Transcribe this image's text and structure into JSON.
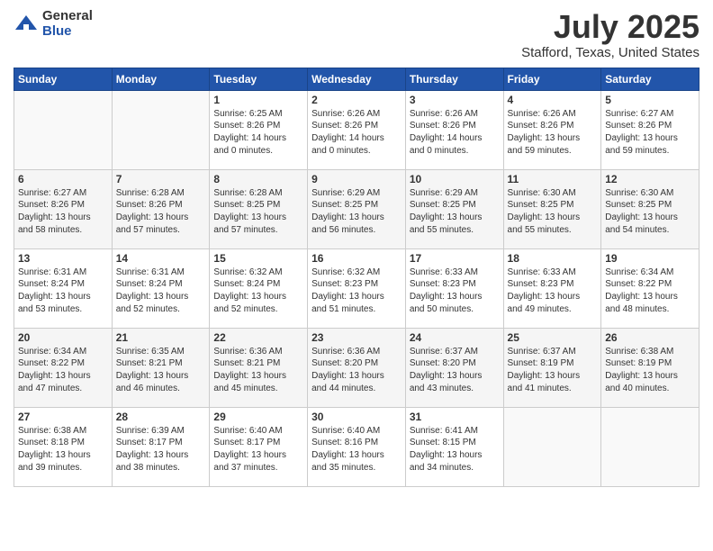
{
  "logo": {
    "general": "General",
    "blue": "Blue"
  },
  "title": "July 2025",
  "location": "Stafford, Texas, United States",
  "days_of_week": [
    "Sunday",
    "Monday",
    "Tuesday",
    "Wednesday",
    "Thursday",
    "Friday",
    "Saturday"
  ],
  "weeks": [
    [
      {
        "day": "",
        "sunrise": "",
        "sunset": "",
        "daylight": ""
      },
      {
        "day": "",
        "sunrise": "",
        "sunset": "",
        "daylight": ""
      },
      {
        "day": "1",
        "sunrise": "Sunrise: 6:25 AM",
        "sunset": "Sunset: 8:26 PM",
        "daylight": "Daylight: 14 hours and 0 minutes."
      },
      {
        "day": "2",
        "sunrise": "Sunrise: 6:26 AM",
        "sunset": "Sunset: 8:26 PM",
        "daylight": "Daylight: 14 hours and 0 minutes."
      },
      {
        "day": "3",
        "sunrise": "Sunrise: 6:26 AM",
        "sunset": "Sunset: 8:26 PM",
        "daylight": "Daylight: 14 hours and 0 minutes."
      },
      {
        "day": "4",
        "sunrise": "Sunrise: 6:26 AM",
        "sunset": "Sunset: 8:26 PM",
        "daylight": "Daylight: 13 hours and 59 minutes."
      },
      {
        "day": "5",
        "sunrise": "Sunrise: 6:27 AM",
        "sunset": "Sunset: 8:26 PM",
        "daylight": "Daylight: 13 hours and 59 minutes."
      }
    ],
    [
      {
        "day": "6",
        "sunrise": "Sunrise: 6:27 AM",
        "sunset": "Sunset: 8:26 PM",
        "daylight": "Daylight: 13 hours and 58 minutes."
      },
      {
        "day": "7",
        "sunrise": "Sunrise: 6:28 AM",
        "sunset": "Sunset: 8:26 PM",
        "daylight": "Daylight: 13 hours and 57 minutes."
      },
      {
        "day": "8",
        "sunrise": "Sunrise: 6:28 AM",
        "sunset": "Sunset: 8:25 PM",
        "daylight": "Daylight: 13 hours and 57 minutes."
      },
      {
        "day": "9",
        "sunrise": "Sunrise: 6:29 AM",
        "sunset": "Sunset: 8:25 PM",
        "daylight": "Daylight: 13 hours and 56 minutes."
      },
      {
        "day": "10",
        "sunrise": "Sunrise: 6:29 AM",
        "sunset": "Sunset: 8:25 PM",
        "daylight": "Daylight: 13 hours and 55 minutes."
      },
      {
        "day": "11",
        "sunrise": "Sunrise: 6:30 AM",
        "sunset": "Sunset: 8:25 PM",
        "daylight": "Daylight: 13 hours and 55 minutes."
      },
      {
        "day": "12",
        "sunrise": "Sunrise: 6:30 AM",
        "sunset": "Sunset: 8:25 PM",
        "daylight": "Daylight: 13 hours and 54 minutes."
      }
    ],
    [
      {
        "day": "13",
        "sunrise": "Sunrise: 6:31 AM",
        "sunset": "Sunset: 8:24 PM",
        "daylight": "Daylight: 13 hours and 53 minutes."
      },
      {
        "day": "14",
        "sunrise": "Sunrise: 6:31 AM",
        "sunset": "Sunset: 8:24 PM",
        "daylight": "Daylight: 13 hours and 52 minutes."
      },
      {
        "day": "15",
        "sunrise": "Sunrise: 6:32 AM",
        "sunset": "Sunset: 8:24 PM",
        "daylight": "Daylight: 13 hours and 52 minutes."
      },
      {
        "day": "16",
        "sunrise": "Sunrise: 6:32 AM",
        "sunset": "Sunset: 8:23 PM",
        "daylight": "Daylight: 13 hours and 51 minutes."
      },
      {
        "day": "17",
        "sunrise": "Sunrise: 6:33 AM",
        "sunset": "Sunset: 8:23 PM",
        "daylight": "Daylight: 13 hours and 50 minutes."
      },
      {
        "day": "18",
        "sunrise": "Sunrise: 6:33 AM",
        "sunset": "Sunset: 8:23 PM",
        "daylight": "Daylight: 13 hours and 49 minutes."
      },
      {
        "day": "19",
        "sunrise": "Sunrise: 6:34 AM",
        "sunset": "Sunset: 8:22 PM",
        "daylight": "Daylight: 13 hours and 48 minutes."
      }
    ],
    [
      {
        "day": "20",
        "sunrise": "Sunrise: 6:34 AM",
        "sunset": "Sunset: 8:22 PM",
        "daylight": "Daylight: 13 hours and 47 minutes."
      },
      {
        "day": "21",
        "sunrise": "Sunrise: 6:35 AM",
        "sunset": "Sunset: 8:21 PM",
        "daylight": "Daylight: 13 hours and 46 minutes."
      },
      {
        "day": "22",
        "sunrise": "Sunrise: 6:36 AM",
        "sunset": "Sunset: 8:21 PM",
        "daylight": "Daylight: 13 hours and 45 minutes."
      },
      {
        "day": "23",
        "sunrise": "Sunrise: 6:36 AM",
        "sunset": "Sunset: 8:20 PM",
        "daylight": "Daylight: 13 hours and 44 minutes."
      },
      {
        "day": "24",
        "sunrise": "Sunrise: 6:37 AM",
        "sunset": "Sunset: 8:20 PM",
        "daylight": "Daylight: 13 hours and 43 minutes."
      },
      {
        "day": "25",
        "sunrise": "Sunrise: 6:37 AM",
        "sunset": "Sunset: 8:19 PM",
        "daylight": "Daylight: 13 hours and 41 minutes."
      },
      {
        "day": "26",
        "sunrise": "Sunrise: 6:38 AM",
        "sunset": "Sunset: 8:19 PM",
        "daylight": "Daylight: 13 hours and 40 minutes."
      }
    ],
    [
      {
        "day": "27",
        "sunrise": "Sunrise: 6:38 AM",
        "sunset": "Sunset: 8:18 PM",
        "daylight": "Daylight: 13 hours and 39 minutes."
      },
      {
        "day": "28",
        "sunrise": "Sunrise: 6:39 AM",
        "sunset": "Sunset: 8:17 PM",
        "daylight": "Daylight: 13 hours and 38 minutes."
      },
      {
        "day": "29",
        "sunrise": "Sunrise: 6:40 AM",
        "sunset": "Sunset: 8:17 PM",
        "daylight": "Daylight: 13 hours and 37 minutes."
      },
      {
        "day": "30",
        "sunrise": "Sunrise: 6:40 AM",
        "sunset": "Sunset: 8:16 PM",
        "daylight": "Daylight: 13 hours and 35 minutes."
      },
      {
        "day": "31",
        "sunrise": "Sunrise: 6:41 AM",
        "sunset": "Sunset: 8:15 PM",
        "daylight": "Daylight: 13 hours and 34 minutes."
      },
      {
        "day": "",
        "sunrise": "",
        "sunset": "",
        "daylight": ""
      },
      {
        "day": "",
        "sunrise": "",
        "sunset": "",
        "daylight": ""
      }
    ]
  ]
}
